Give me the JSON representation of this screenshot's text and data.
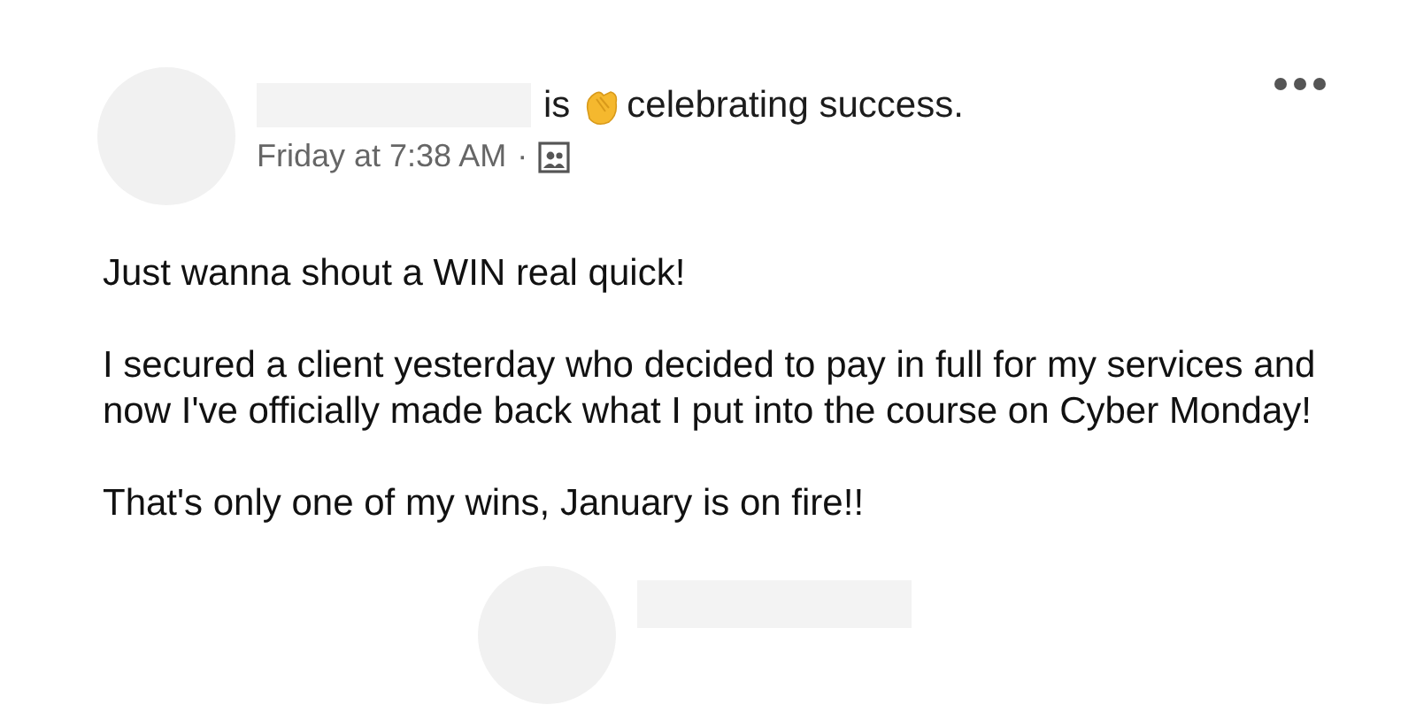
{
  "post": {
    "status_verb": "is",
    "status_text": "celebrating success.",
    "timestamp": "Friday at 7:38 AM",
    "separator": "·",
    "paragraphs": [
      "Just wanna shout a WIN real quick!",
      "I secured a client yesterday who decided to pay in full for my services and now I've officially made back what I put into the course on Cyber Monday!",
      "That's only one of my wins, January is on fire!!"
    ]
  }
}
